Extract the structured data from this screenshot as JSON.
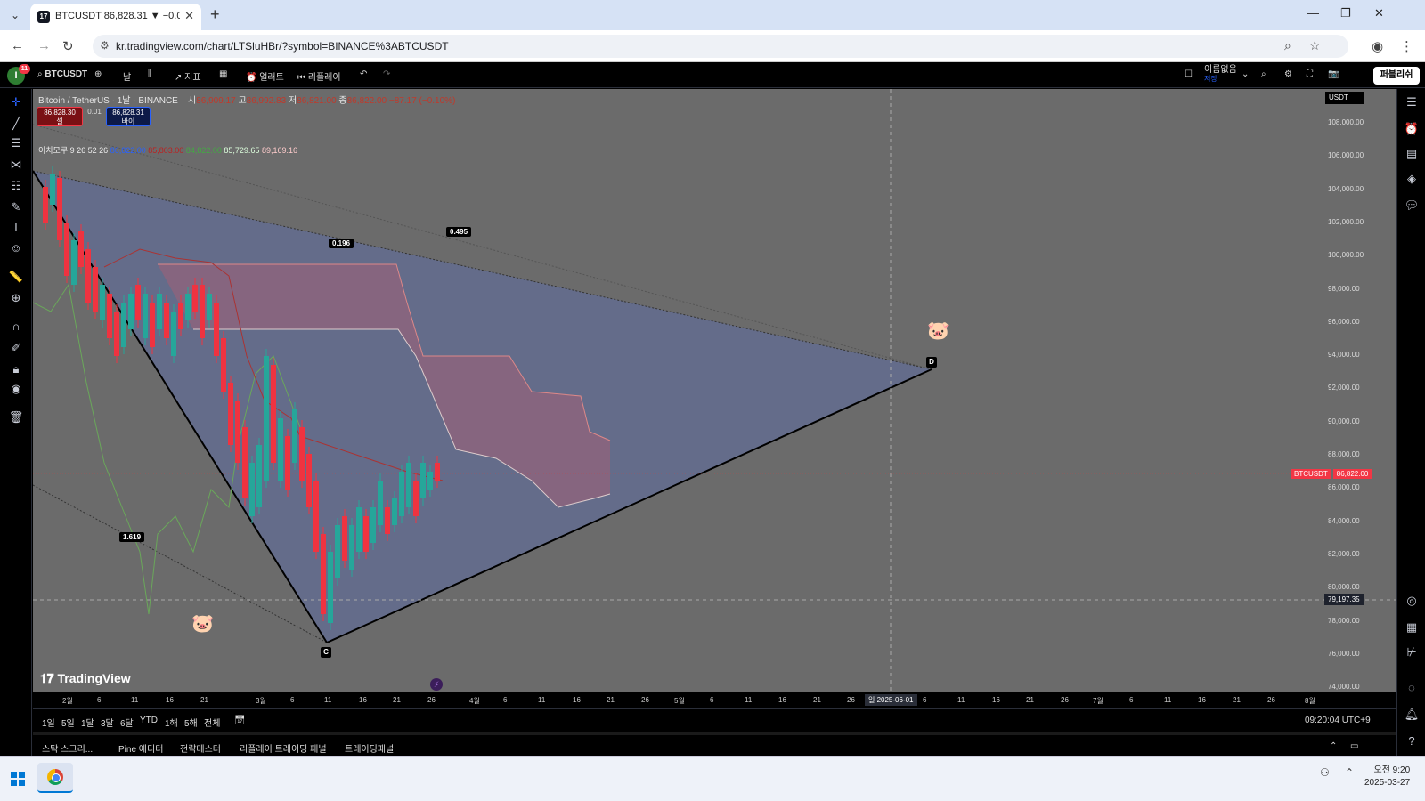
{
  "browser": {
    "tab_title": "BTCUSDT 86,828.31 ▼ −0.09%",
    "url": "kr.tradingview.com/chart/LTSluHBr/?symbol=BINANCE%3ABTCUSDT"
  },
  "toolbar": {
    "symbol": "BTCUSDT",
    "interval": "날",
    "indicators": "지표",
    "alert": "얼러트",
    "replay": "리플레이",
    "layout_name": "이름없음",
    "layout_sub": "저장",
    "publish": "퍼블리쉬",
    "notif_count": "11"
  },
  "legend": {
    "pair": "Bitcoin / TetherUS · 1날 · BINANCE",
    "ohlc_label_o": "시",
    "ohlc_o": "86,909.17",
    "ohlc_label_h": "고",
    "ohlc_h": "86,992.83",
    "ohlc_label_l": "저",
    "ohlc_l": "86,821.00",
    "ohlc_label_c": "종",
    "ohlc_c": "86,822.00",
    "change": "−87.17 (−0.10%)",
    "sell_price": "86,828.30",
    "sell_label": "셀",
    "spread": "0.01",
    "buy_price": "86,828.31",
    "buy_label": "바이",
    "ichimoku_label": "이치모쿠 9 26 52 26",
    "ichimoku_v1": "86,822.00",
    "ichimoku_v2": "85,803.00",
    "ichimoku_v3": "84,822.00",
    "ichimoku_v4": "85,729.65",
    "ichimoku_v5": "89,169.16"
  },
  "drawing": {
    "fib_labels": [
      "0.196",
      "0.495",
      "1.619"
    ],
    "point_c": "C",
    "point_d": "D"
  },
  "yaxis": {
    "currency": "USDT",
    "ticks": [
      "108,000.00",
      "106,000.00",
      "104,000.00",
      "102,000.00",
      "100,000.00",
      "98,000.00",
      "96,000.00",
      "94,000.00",
      "92,000.00",
      "90,000.00",
      "88,000.00",
      "86,000.00",
      "84,000.00",
      "82,000.00",
      "80,000.00",
      "78,000.00",
      "76,000.00",
      "74,000.00"
    ],
    "last_symbol": "BTCUSDT",
    "last_price": "86,822.00",
    "cross_price": "79,197.35"
  },
  "xaxis": {
    "ticks": [
      "2월",
      "6",
      "11",
      "16",
      "21",
      "3월",
      "6",
      "11",
      "16",
      "21",
      "26",
      "4월",
      "6",
      "11",
      "16",
      "21",
      "26",
      "5월",
      "6",
      "11",
      "16",
      "21",
      "26",
      "6",
      "11",
      "16",
      "21",
      "26",
      "7월",
      "6",
      "11",
      "16",
      "21",
      "26",
      "8월"
    ],
    "crosshair_date": "일 2025-06-01"
  },
  "ranges": [
    "1일",
    "5일",
    "1달",
    "3달",
    "6달",
    "YTD",
    "1해",
    "5해",
    "전체"
  ],
  "clock_utc": "09:20:04 UTC+9",
  "panels": [
    "스탁 스크리...",
    "Pine 에디터",
    "전략테스터",
    "리플레이 트레이딩 패널",
    "트레이딩패널"
  ],
  "taskbar": {
    "time": "오전 9:20",
    "date": "2025-03-27"
  },
  "logo_text": "TradingView"
}
